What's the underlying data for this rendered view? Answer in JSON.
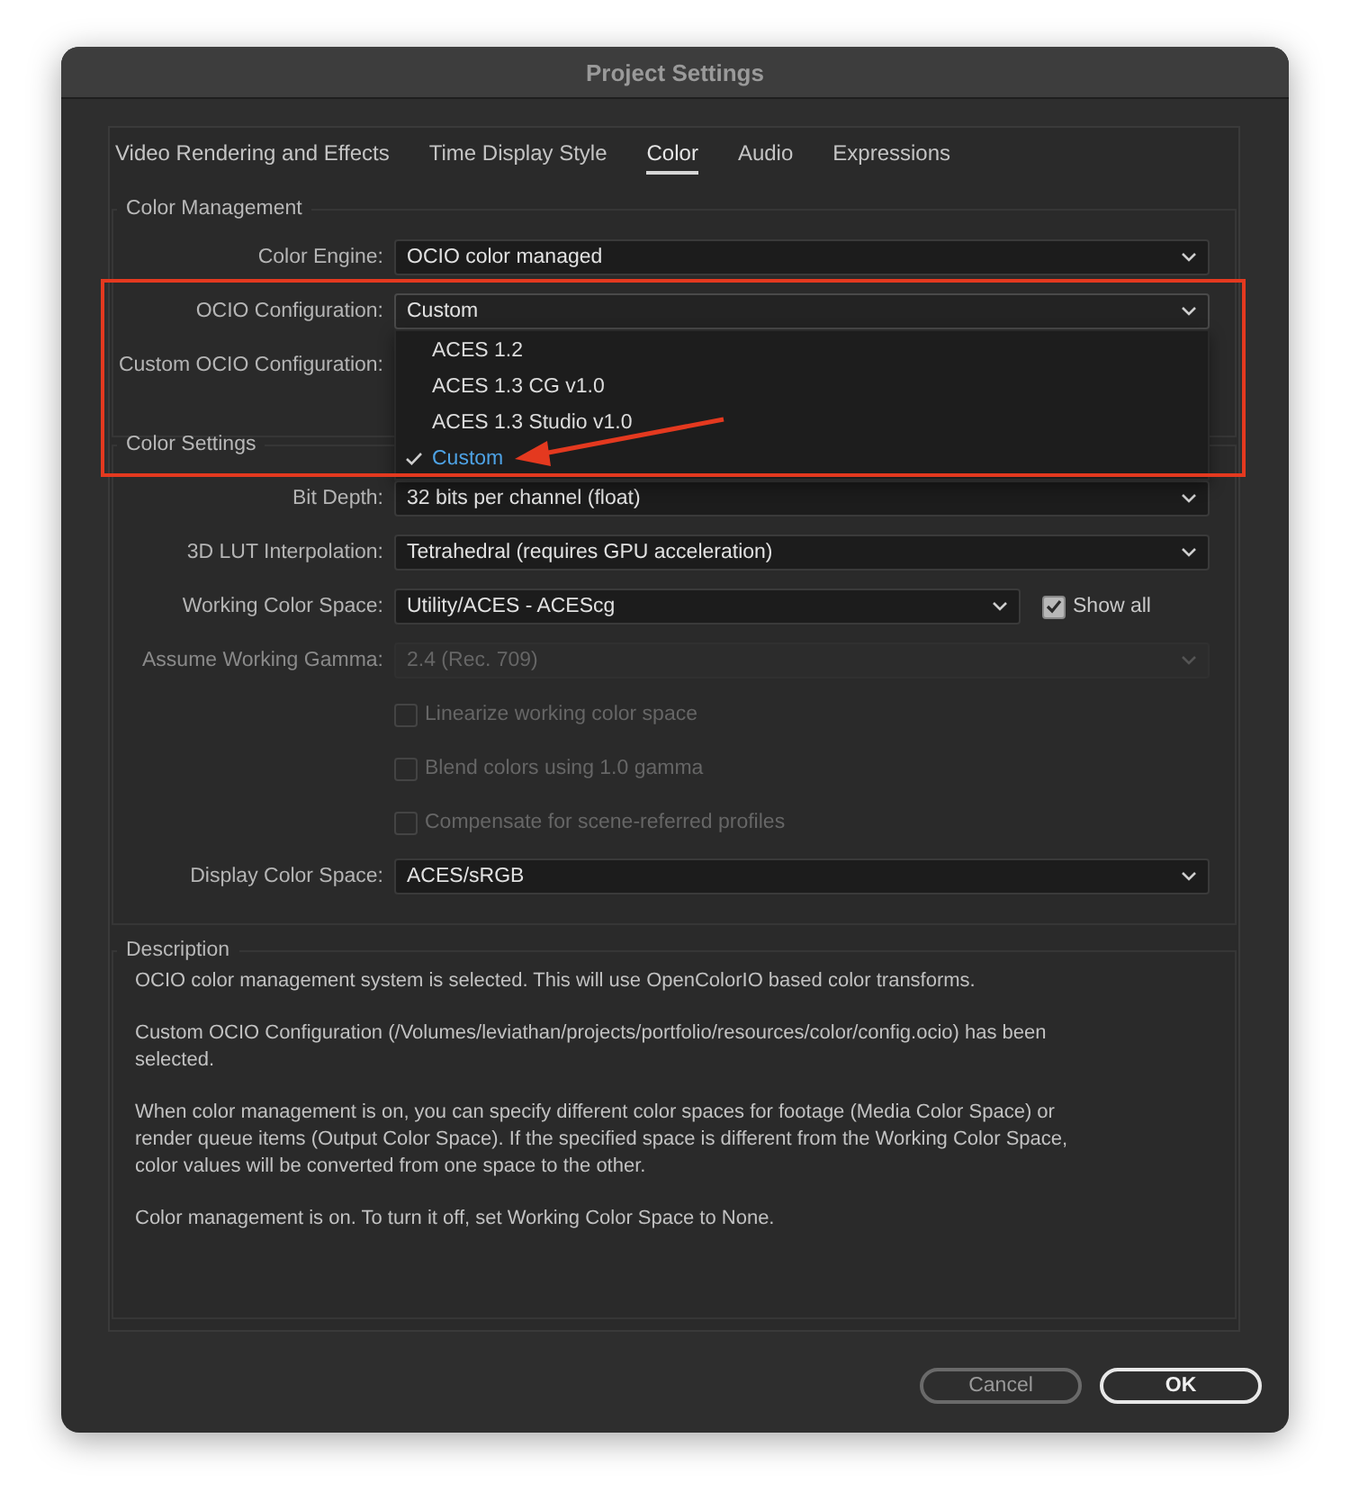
{
  "window": {
    "title": "Project Settings"
  },
  "tabs": [
    {
      "label": "Video Rendering and Effects",
      "selected": false
    },
    {
      "label": "Time Display Style",
      "selected": false
    },
    {
      "label": "Color",
      "selected": true
    },
    {
      "label": "Audio",
      "selected": false
    },
    {
      "label": "Expressions",
      "selected": false
    }
  ],
  "color_management": {
    "heading": "Color Management",
    "rows": [
      {
        "kind": "select",
        "label": "Color Engine:",
        "value": "OCIO color managed",
        "expanded": false
      },
      {
        "kind": "select",
        "label": "OCIO Configuration:",
        "value": "Custom",
        "expanded": true,
        "options": [
          {
            "label": "ACES 1.2",
            "selected": false
          },
          {
            "label": "ACES 1.3 CG v1.0",
            "selected": false
          },
          {
            "label": "ACES 1.3 Studio v1.0",
            "selected": false
          },
          {
            "label": "Custom",
            "selected": true
          }
        ]
      },
      {
        "kind": "covered",
        "label": "Custom OCIO Configuration:"
      }
    ]
  },
  "color_settings": {
    "heading": "Color Settings",
    "rows": [
      {
        "kind": "select",
        "label": "Bit Depth:",
        "value": "32 bits per channel (float)",
        "disabled": false
      },
      {
        "kind": "select",
        "label": "3D LUT Interpolation:",
        "value": "Tetrahedral (requires GPU acceleration)",
        "disabled": false
      },
      {
        "kind": "select",
        "label": "Working Color Space:",
        "value": "Utility/ACES - ACEScg",
        "disabled": false,
        "option": {
          "label": "Show all",
          "checked": true
        }
      },
      {
        "kind": "select",
        "label": "Assume Working Gamma:",
        "value": "2.4 (Rec. 709)",
        "disabled": true
      },
      {
        "kind": "checkbox",
        "label": "Linearize working color space",
        "checked": false,
        "disabled": true
      },
      {
        "kind": "checkbox",
        "label": "Blend colors using 1.0 gamma",
        "checked": false,
        "disabled": true
      },
      {
        "kind": "checkbox",
        "label": "Compensate for scene-referred profiles",
        "checked": false,
        "disabled": true
      },
      {
        "kind": "select",
        "label": "Display Color Space:",
        "value": "ACES/sRGB",
        "disabled": false
      }
    ]
  },
  "description": {
    "heading": "Description",
    "paragraphs": [
      "OCIO color management system is selected. This will use OpenColorIO based color transforms.",
      "Custom OCIO Configuration (/Volumes/leviathan/projects/portfolio/resources/color/config.ocio) has been selected.",
      "When color management is on, you can specify different color spaces for footage (Media Color Space) or render queue items (Output Color Space). If the specified space is different from the Working Color Space, color values will be converted from one space to the other.",
      "Color management is on. To turn it off, set Working Color Space to None."
    ]
  },
  "buttons": [
    {
      "label": "Cancel",
      "kind": "secondary"
    },
    {
      "label": "OK",
      "kind": "primary"
    }
  ]
}
